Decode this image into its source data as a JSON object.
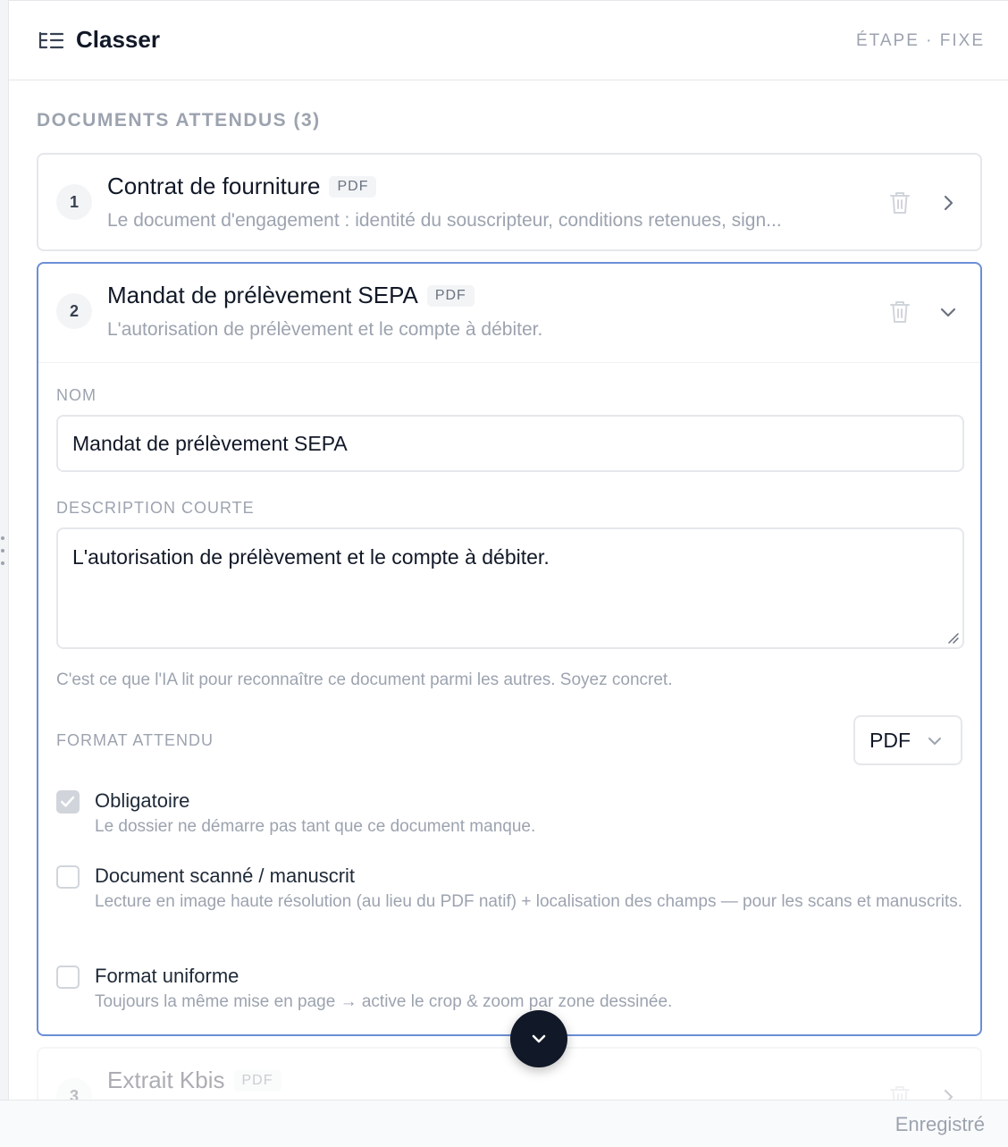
{
  "header": {
    "title": "Classer",
    "step_label": "ÉTAPE · FIXE",
    "icon": "tree-list-icon"
  },
  "section": {
    "label": "DOCUMENTS ATTENDUS (3)"
  },
  "documents": [
    {
      "number": "1",
      "name": "Contrat de fourniture",
      "format_tag": "PDF",
      "description": "Le document d'engagement : identité du souscripteur, conditions retenues, sign...",
      "state": "collapsed"
    },
    {
      "number": "2",
      "name": "Mandat de prélèvement SEPA",
      "format_tag": "PDF",
      "description": "L'autorisation de prélèvement et le compte à débiter.",
      "state": "expanded"
    },
    {
      "number": "3",
      "name": "Extrait Kbis",
      "format_tag": "PDF",
      "state": "collapsed"
    }
  ],
  "editor": {
    "name_label": "NOM",
    "name_value": "Mandat de prélèvement SEPA",
    "desc_label": "DESCRIPTION COURTE",
    "desc_value": "L'autorisation de prélèvement et le compte à débiter.",
    "desc_hint": "C'est ce que l'IA lit pour reconnaître ce document parmi les autres. Soyez concret.",
    "format_label": "FORMAT ATTENDU",
    "format_value": "PDF",
    "options": [
      {
        "title": "Obligatoire",
        "description": "Le dossier ne démarre pas tant que ce document manque.",
        "checked": true
      },
      {
        "title": "Document scanné / manuscrit",
        "description": "Lecture en image haute résolution (au lieu du PDF natif) + localisation des champs — pour les scans et manuscrits.",
        "checked": false
      },
      {
        "title": "Format uniforme",
        "description": "Toujours la même mise en page → active le crop & zoom par zone dessinée.",
        "checked": false
      }
    ]
  },
  "footer": {
    "status": "Enregistré"
  },
  "colors": {
    "accent_border": "#6b8fd6",
    "fab": "#111827",
    "muted_text": "#9ca3af"
  }
}
